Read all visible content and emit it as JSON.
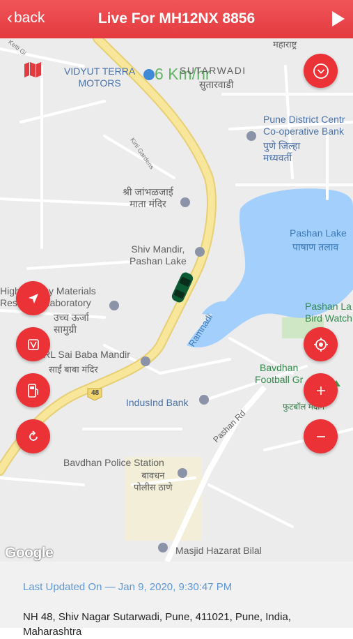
{
  "header": {
    "back_label": "back",
    "title": "Live For MH12NX 8856"
  },
  "map": {
    "speed": "6 Km/hr",
    "vehicle_number": "MH12NX 8856",
    "places": {
      "vidyut": "VIDYUT TERRA\nMOTORS",
      "sutarwadi": "SUTARWADI",
      "sutarwadi_mr": "सुतारवाडी",
      "maharashtra": "महाराष्ट्र",
      "ketti": "Ketti Gi",
      "pune_district": "Pune District Centr\nCo-operative Bank",
      "pune_district_mr": "पुणे जिल्हा\nमध्यवर्ती",
      "kirti": "Kirti Gardens",
      "jambhalai": "श्री जांभळजाई\nमाता मंदिर",
      "shiv_mandir": "Shiv Mandir,\nPashan Lake",
      "pashan_lake": "Pashan Lake",
      "pashan_lake_mr": "पाषाण तलाव",
      "high_energy": "High Energy Materials\nResearch Laboratory",
      "high_energy_mr": "उच्च ऊर्जा\nसामुग्री",
      "ramnadi": "Ramnadi",
      "pashan_bird": "Pashan La\nBird Watch",
      "sai_baba": "HEMRL Sai Baba Mandir",
      "sai_baba_mr": "साईं बाबा मंदिर",
      "bavdhan_football": "Bavdhan\nFootball Gr",
      "football_mr": "फुटबॉल मैदान",
      "nh48": "48",
      "indusind": "IndusInd Bank",
      "pashan_rd": "Pashan Rd",
      "bavdhan_police": "Bavdhan Police Station",
      "bavdhan_police_mr": "बावधन\nपोलीस ठाणे",
      "masjid": "Masjid Hazarat Bilal",
      "google": "Google"
    }
  },
  "footer": {
    "last_updated": "Last Updated On — Jan 9, 2020, 9:30:47 PM",
    "address": "NH 48, Shiv Nagar Sutarwadi, Pune, 411021, Pune, India, Maharashtra"
  },
  "colors": {
    "accent": "#ea3237",
    "road_major": "#f7e38a",
    "lake": "#9fcfff",
    "updated_text": "#5d97d8"
  }
}
